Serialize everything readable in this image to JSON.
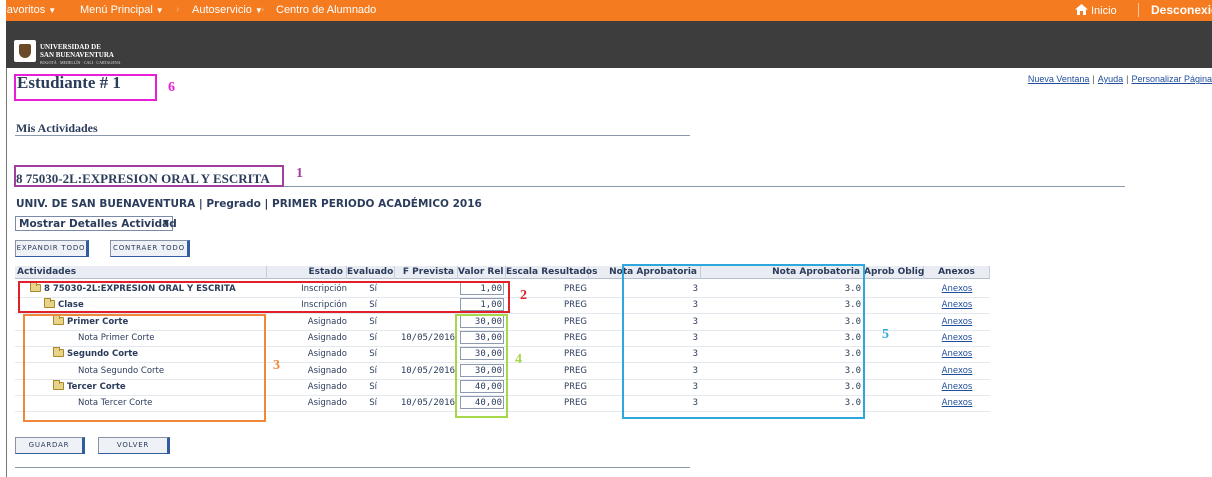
{
  "nav": {
    "favoritos": "Favoritos",
    "menu_principal": "Menú Principal",
    "sep": "›",
    "autoservicio": "Autoservicio",
    "centro": "Centro de Alumnado",
    "caret": "▼",
    "inicio": "Inicio",
    "desconexion": "Desconexión"
  },
  "brand": {
    "line1": "UNIVERSIDAD DE",
    "line2": "SAN BUENAVENTURA",
    "line3": "BOGOTÁ · MEDELLÍN · CALI · CARTAGENA"
  },
  "toplinks": {
    "nueva": "Nueva Ventana",
    "ayuda": "Ayuda",
    "personalizar": "Personalizar Página",
    "pipe": "|"
  },
  "page": {
    "title": "Estudiante # 1",
    "section": "Mis Actividades",
    "course": "8 75030-2L:EXPRESION ORAL Y ESCRITA",
    "subline": "UNIV. DE SAN BUENAVENTURA | Pregrado | PRIMER PERIODO ACADÉMICO 2016",
    "dropdown": "Mostrar Detalles Actividad",
    "dropdown_arrow": "▼"
  },
  "buttons": {
    "expandir": "EXPANDIR TODO",
    "contraer": "CONTRAER TODO",
    "guardar": "GUARDAR",
    "volver": "VOLVER"
  },
  "table": {
    "headers": {
      "actividades": "Actividades",
      "estado": "Estado",
      "evaluado": "Evaluado",
      "fprevista": "F Prevista",
      "valor": "Valor Rel",
      "escala": "Escala Resultados",
      "nota1": "Nota Aprobatoria",
      "nota2": "Nota Aprobatoria",
      "aprob": "Aprob Oblig",
      "anexos": "Anexos"
    },
    "rows": [
      {
        "name": "8 75030-2L:EXPRESION ORAL Y ESCRITA",
        "estado": "Inscripción",
        "evaluado": "Sí",
        "fecha": "",
        "valor": "1,00",
        "escala": "PREG",
        "nota1": "3",
        "nota2": "3.0",
        "anexos": "Anexos"
      },
      {
        "name": "Clase",
        "estado": "Inscripción",
        "evaluado": "Sí",
        "fecha": "",
        "valor": "1,00",
        "escala": "PREG",
        "nota1": "3",
        "nota2": "3.0",
        "anexos": "Anexos"
      },
      {
        "name": "Primer Corte",
        "estado": "Asignado",
        "evaluado": "Sí",
        "fecha": "",
        "valor": "30,00",
        "escala": "PREG",
        "nota1": "3",
        "nota2": "3.0",
        "anexos": "Anexos"
      },
      {
        "name": "Nota Primer Corte",
        "estado": "Asignado",
        "evaluado": "Sí",
        "fecha": "10/05/2016",
        "valor": "30,00",
        "escala": "PREG",
        "nota1": "3",
        "nota2": "3.0",
        "anexos": "Anexos"
      },
      {
        "name": "Segundo Corte",
        "estado": "Asignado",
        "evaluado": "Sí",
        "fecha": "",
        "valor": "30,00",
        "escala": "PREG",
        "nota1": "3",
        "nota2": "3.0",
        "anexos": "Anexos"
      },
      {
        "name": "Nota Segundo Corte",
        "estado": "Asignado",
        "evaluado": "Sí",
        "fecha": "10/05/2016",
        "valor": "30,00",
        "escala": "PREG",
        "nota1": "3",
        "nota2": "3.0",
        "anexos": "Anexos"
      },
      {
        "name": "Tercer Corte",
        "estado": "Asignado",
        "evaluado": "Sí",
        "fecha": "",
        "valor": "40,00",
        "escala": "PREG",
        "nota1": "3",
        "nota2": "3.0",
        "anexos": "Anexos"
      },
      {
        "name": "Nota Tercer Corte",
        "estado": "Asignado",
        "evaluado": "Sí",
        "fecha": "10/05/2016",
        "valor": "40,00",
        "escala": "PREG",
        "nota1": "3",
        "nota2": "3.0",
        "anexos": "Anexos"
      }
    ]
  },
  "annotations": {
    "n1": "1",
    "n2": "2",
    "n3": "3",
    "n4": "4",
    "n5": "5",
    "n6": "6",
    "colors": {
      "c1": "#a0409d",
      "c2": "#e0212b",
      "c3": "#f0883c",
      "c4": "#a6d84a",
      "c5": "#2ea7dc",
      "c6": "#e81fd7"
    }
  }
}
